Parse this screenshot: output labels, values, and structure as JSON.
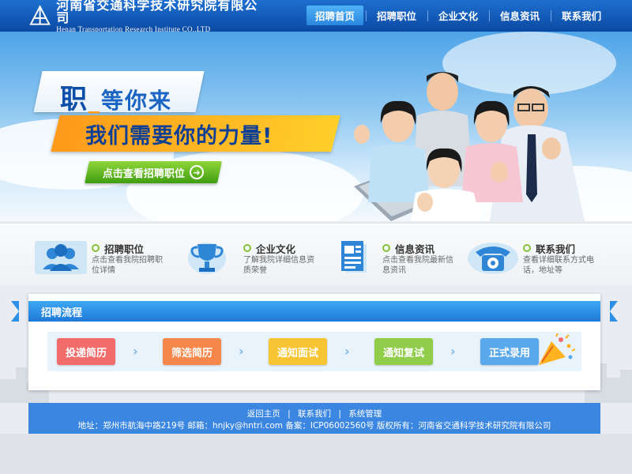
{
  "header": {
    "logo_cn": "河南省交通科学技术研究院有限公司",
    "logo_en": "Henan Transportation Research Institute CO.,LTD",
    "nav": [
      {
        "label": "招聘首页",
        "active": true
      },
      {
        "label": "招聘职位",
        "active": false
      },
      {
        "label": "企业文化",
        "active": false
      },
      {
        "label": "信息资讯",
        "active": false
      },
      {
        "label": "联系我们",
        "active": false
      }
    ]
  },
  "banner": {
    "title_big": "职",
    "title_rest": "等你来",
    "subtitle": "我们需要你的力量!",
    "cta_label": "点击查看招聘职位"
  },
  "features": [
    {
      "title": "招聘职位",
      "desc": "点击查看我院招聘职位详情",
      "icon": "people-icon"
    },
    {
      "title": "企业文化",
      "desc": "了解我院详细信息资质荣誉",
      "icon": "trophy-icon"
    },
    {
      "title": "信息资讯",
      "desc": "点击查看我院最新信息资讯",
      "icon": "document-icon"
    },
    {
      "title": "联系我们",
      "desc": "查看详细联系方式电话，地址等",
      "icon": "phone-icon"
    }
  ],
  "process": {
    "title": "招聘流程",
    "steps": [
      {
        "label": "投递简历",
        "color": "#f26c6c"
      },
      {
        "label": "筛选简历",
        "color": "#f5874a"
      },
      {
        "label": "通知面试",
        "color": "#f7c534"
      },
      {
        "label": "通知复试",
        "color": "#8fcd4a"
      },
      {
        "label": "正式录用",
        "color": "#5aa9ec"
      }
    ]
  },
  "footer": {
    "links": [
      "返回主页",
      "联系我们",
      "系统管理"
    ],
    "info": "地址：郑州市航海中路219号  邮箱：hnjky@hntri.com  备案：ICP06002560号  版权所有：河南省交通科学技术研究院有限公司"
  },
  "colors": {
    "header_blue": "#0b4aa3",
    "accent_orange": "#ffb21f",
    "cta_green": "#5bb522",
    "footer_blue": "#3a86e0"
  }
}
